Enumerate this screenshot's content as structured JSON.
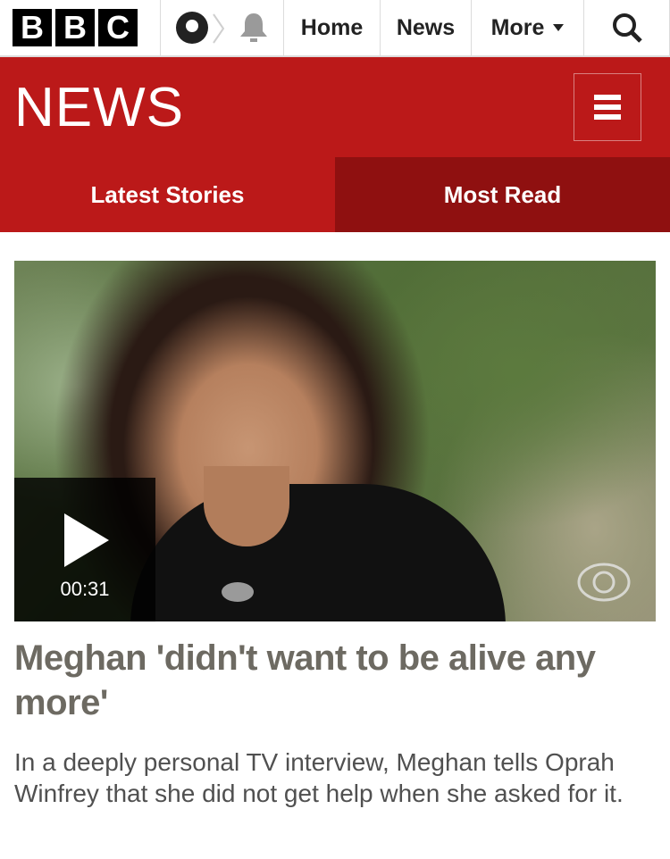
{
  "topbar": {
    "logo_letters": [
      "B",
      "B",
      "C"
    ],
    "account_icon": "account-icon",
    "notification_icon": "bell-icon",
    "nav": {
      "home_label": "Home",
      "news_label": "News",
      "more_label": "More"
    },
    "search_icon": "search-icon"
  },
  "news_header": {
    "wordmark": "NEWS",
    "menu_icon": "hamburger-menu-icon",
    "brand_color": "#bb1919"
  },
  "tabs": [
    {
      "label": "Latest Stories",
      "selected": false
    },
    {
      "label": "Most Read",
      "selected": true
    }
  ],
  "story": {
    "video_duration": "00:31",
    "headline": "Meghan 'didn't want to be alive any more'",
    "summary": "In a deeply personal TV interview, Meghan tells Oprah Winfrey that she did not get help when she asked for it."
  }
}
